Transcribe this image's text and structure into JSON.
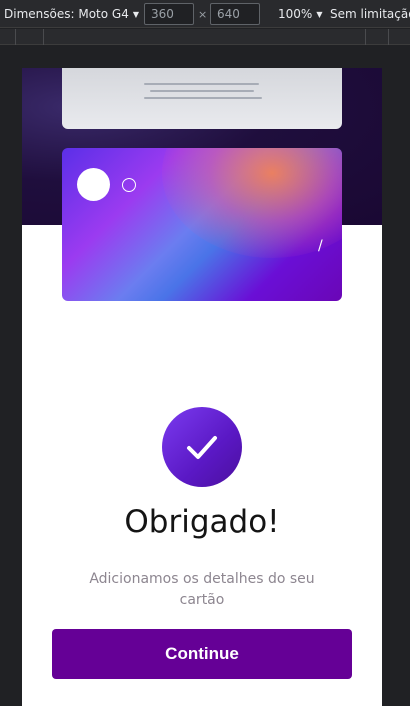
{
  "devtools": {
    "device_label": "Dimensões: Moto G4",
    "width_value": "360",
    "times_symbol": "×",
    "height_value": "640",
    "zoom_label": "100%",
    "throttle_label": "Sem limitação"
  },
  "card": {
    "separator": "/"
  },
  "success": {
    "title": "Obrigado!",
    "message": "Adicionamos os detalhes do seu cartão",
    "continue_label": "Continue"
  },
  "colors": {
    "accent": "#650096",
    "hero_bg": "#1f0e3d"
  }
}
